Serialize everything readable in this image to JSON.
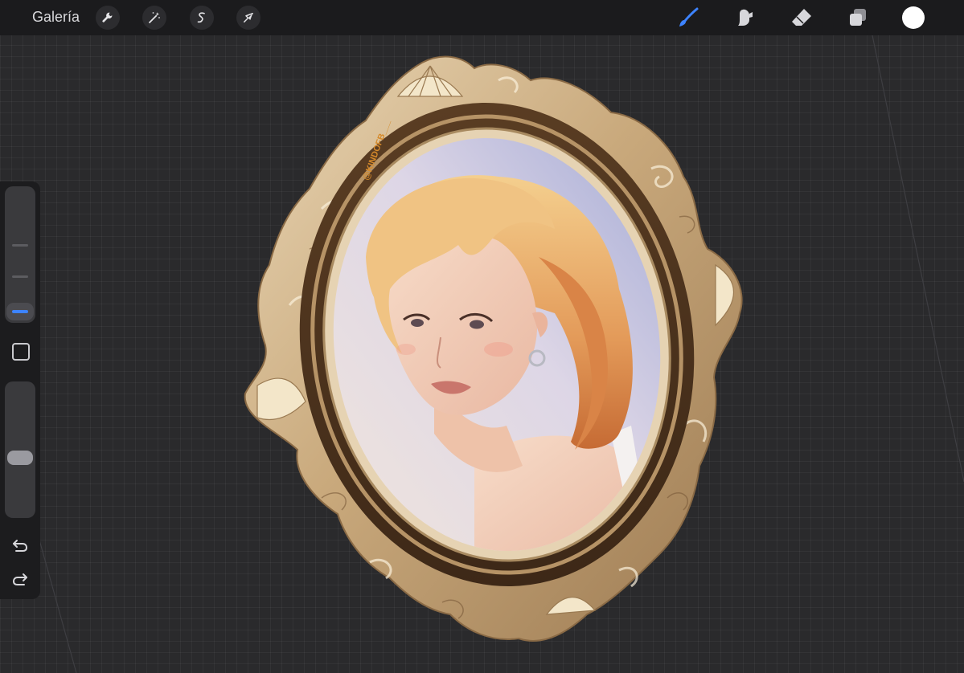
{
  "topbar": {
    "gallery_label": "Galería",
    "left_tools": [
      {
        "name": "actions",
        "icon": "wrench-icon"
      },
      {
        "name": "adjustments",
        "icon": "magic-wand-icon"
      },
      {
        "name": "selection",
        "icon": "selection-s-icon"
      },
      {
        "name": "transform",
        "icon": "arrow-cursor-icon"
      }
    ],
    "right_tools": [
      {
        "name": "brush",
        "icon": "brush-icon",
        "active": true
      },
      {
        "name": "smudge",
        "icon": "smudge-icon"
      },
      {
        "name": "eraser",
        "icon": "eraser-icon"
      },
      {
        "name": "layers",
        "icon": "layers-icon"
      },
      {
        "name": "color",
        "icon": "color-swatch"
      }
    ],
    "active_color": "#3d83ff",
    "current_color": "#ffffff"
  },
  "canvas": {
    "watermark": "@KINDOFB___"
  },
  "sidebar": {
    "brush_size_level": 0.1,
    "opacity_level": 0.4,
    "modify_button": "square-modify-icon",
    "undo_icon": "undo-icon",
    "redo_icon": "redo-icon"
  }
}
